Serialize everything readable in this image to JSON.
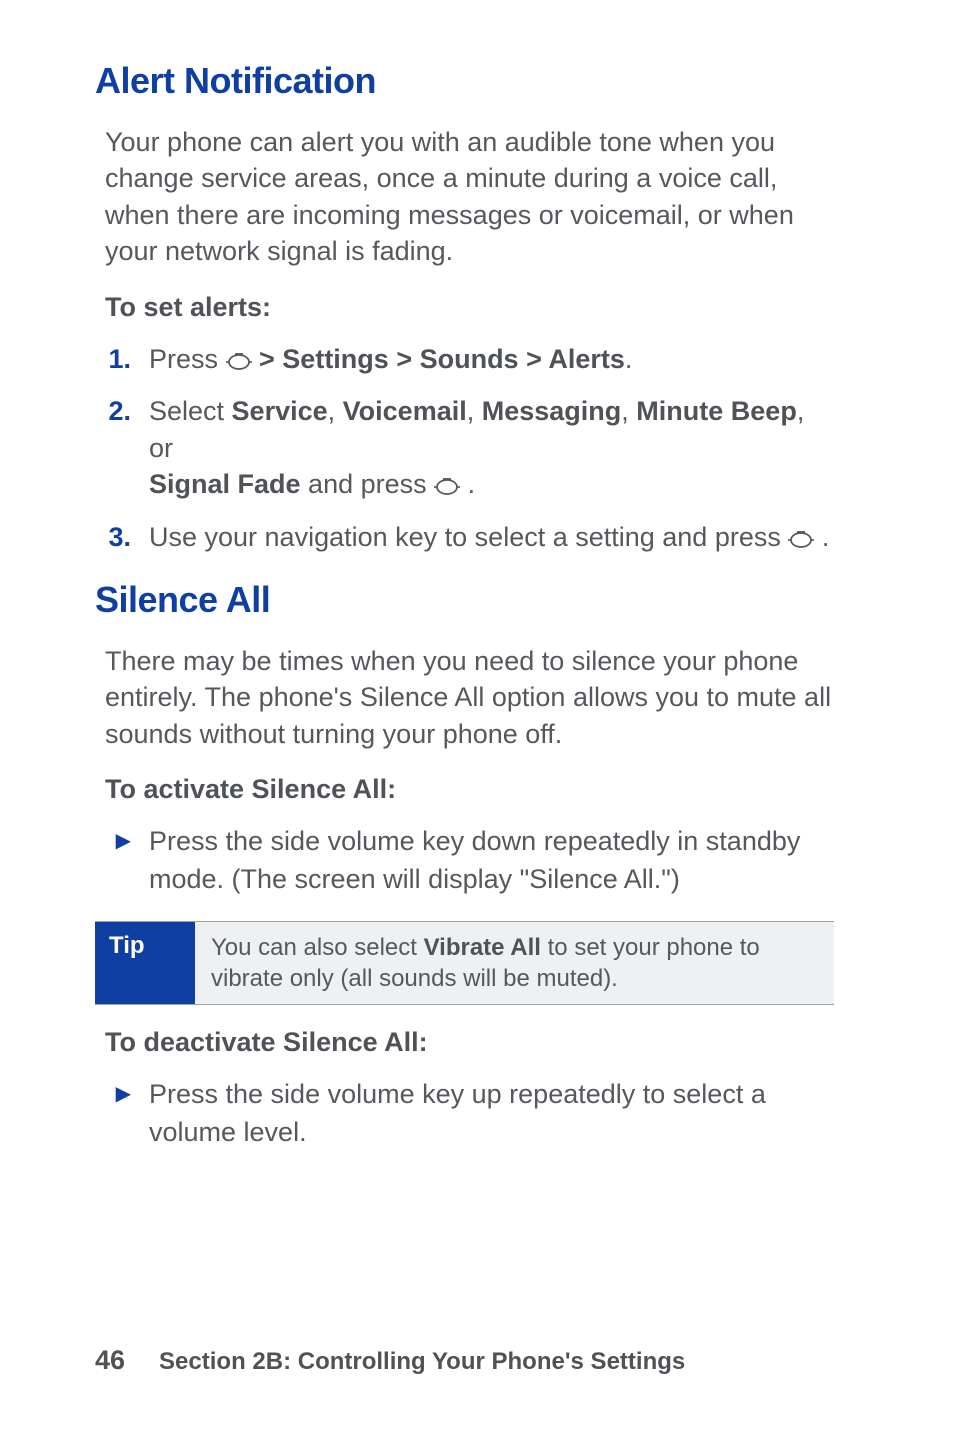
{
  "alert": {
    "heading": "Alert Notification",
    "intro": "Your phone can alert you with an audible tone when you change service areas, once a minute during a voice call, when there are incoming messages or voicemail, or when your network signal is fading.",
    "set_header": "To set alerts:",
    "step1_num": "1.",
    "step1_a": "Press ",
    "step1_b": " > Settings > Sounds > Alerts",
    "step1_c": ".",
    "step2_num": "2.",
    "step2_a": "Select ",
    "step2_service": "Service",
    "step2_sep1": ", ",
    "step2_voicemail": "Voicemail",
    "step2_sep2": ", ",
    "step2_messaging": "Messaging",
    "step2_sep3": ", ",
    "step2_minute": "Minute Beep",
    "step2_sep4": ", or ",
    "step2_signal": "Signal Fade",
    "step2_b": " and press ",
    "step2_c": " .",
    "step3_num": "3.",
    "step3_a": "Use your navigation key to select a setting and press ",
    "step3_b": " ."
  },
  "silence": {
    "heading": "Silence All",
    "intro": "There may be times when you need to silence your phone entirely. The phone's Silence All option allows you to mute all sounds without turning your phone off.",
    "activate_header": "To activate Silence All:",
    "activate_a": "Press the side volume key down repeatedly in standby mode. (The screen will display \"Silence All.\")",
    "tip_label": "Tip",
    "tip_a": "You can also select ",
    "tip_b": "Vibrate All",
    "tip_c": " to set your phone to vibrate only (all sounds will be muted).",
    "deactivate_header": "To deactivate Silence All:",
    "deactivate_a": "Press the side volume key up repeatedly to select a volume level."
  },
  "footer": {
    "page": "46",
    "section": "Section 2B: Controlling Your Phone's Settings"
  },
  "bullet_glyph": "▶"
}
